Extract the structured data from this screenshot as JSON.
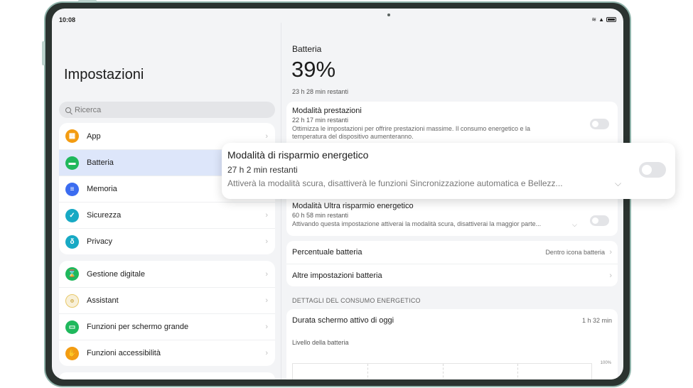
{
  "status_bar": {
    "time": "10:08",
    "wifi_icon": "wifi-icon",
    "signal_icon": "signal-icon",
    "battery_icon": "battery-icon"
  },
  "sidebar": {
    "title": "Impostazioni",
    "search_placeholder": "Ricerca",
    "group1": [
      {
        "label": "App",
        "icon": "app-grid-icon",
        "color": "#f39c12"
      },
      {
        "label": "Batteria",
        "icon": "battery-icon",
        "color": "#1fb85c",
        "active": true
      },
      {
        "label": "Memoria",
        "icon": "storage-icon",
        "color": "#3b6cf0"
      },
      {
        "label": "Sicurezza",
        "icon": "shield-icon",
        "color": "#17a9c4"
      },
      {
        "label": "Privacy",
        "icon": "lock-icon",
        "color": "#17a9c4"
      }
    ],
    "group2": [
      {
        "label": "Gestione digitale",
        "icon": "hourglass-icon",
        "color": "#1fb85c"
      },
      {
        "label": "Assistant",
        "icon": "assistant-icon",
        "color": "#f5d36b"
      },
      {
        "label": "Funzioni per schermo grande",
        "icon": "screen-icon",
        "color": "#1fb85c"
      },
      {
        "label": "Funzioni accessibilità",
        "icon": "hand-icon",
        "color": "#f39c12"
      }
    ]
  },
  "battery": {
    "section": "Batteria",
    "percent": "39%",
    "remaining": "23 h 28 min restanti",
    "modes": [
      {
        "title": "Modalità prestazioni",
        "time": "22 h 17 min restanti",
        "desc_line1": "Ottimizza le impostazioni per offrire prestazioni massime. Il consumo energetico e la",
        "desc_line2": "temperatura del dispositivo aumenteranno."
      },
      {
        "title": "Modalità Ultra risparmio energetico",
        "time": "60 h 58 min restanti",
        "desc": "Attivando questa impostazione attiverai la modalità scura, disattiverai la maggior parte..."
      }
    ],
    "popup": {
      "title": "Modalità di risparmio energetico",
      "time": "27 h 2 min restanti",
      "desc": "Attiverà la modalità scura, disattiverà le funzioni Sincronizzazione automatica e Bellezz..."
    },
    "options": [
      {
        "label": "Percentuale batteria",
        "value": "Dentro icona batteria"
      },
      {
        "label": "Altre impostazioni batteria",
        "value": ""
      }
    ],
    "details_caption": "DETTAGLI DEL CONSUMO ENERGETICO",
    "screen_time_label": "Durata schermo attivo di oggi",
    "screen_time_value": "1 h 32 min",
    "level_label": "Livello della batteria",
    "chart_tick": "100%"
  }
}
